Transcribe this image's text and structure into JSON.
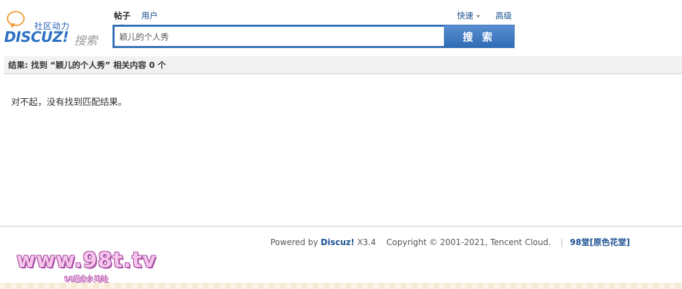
{
  "logo": {
    "tagline": "社区动力",
    "brand": "DISCUZ!",
    "search_word": "搜索"
  },
  "tabs": [
    {
      "label": "帖子",
      "active": true
    },
    {
      "label": "用户",
      "active": false
    }
  ],
  "header_links": {
    "quick": "快速",
    "advanced": "高级"
  },
  "search": {
    "value": "颖儿的个人秀",
    "button_label": "搜 索"
  },
  "results": {
    "summary": "结果: 找到 “颖儿的个人秀” 相关内容 0 个",
    "empty_message": "对不起，没有找到匹配结果。"
  },
  "footer": {
    "powered_prefix": "Powered by",
    "powered_brand": "Discuz!",
    "version": "X3.4",
    "copyright": "Copyright © 2001-2021, Tencent Cloud.",
    "separator": "|",
    "site_link": "98堂[原色花堂]"
  },
  "watermark": {
    "domain": "www.98t.tv",
    "caption": "98堂永久地址"
  },
  "colors": {
    "accent": "#336fb7",
    "link": "#1a4f91",
    "logo_orange": "#f0a13a"
  }
}
